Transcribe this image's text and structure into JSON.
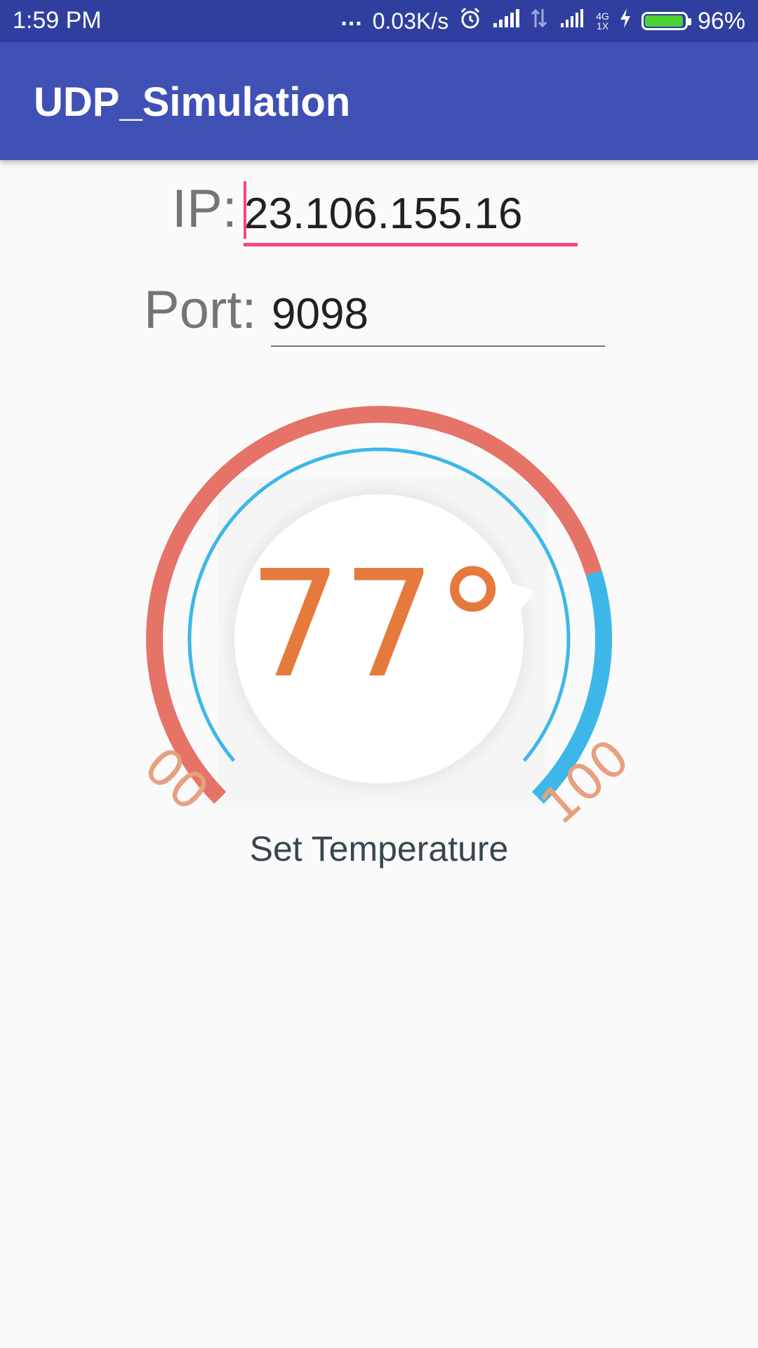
{
  "status_bar": {
    "time": "1:59 PM",
    "dots": "...",
    "net_speed": "0.03K/s",
    "network_label_top": "4G",
    "network_label_bottom": "1X",
    "battery_percent": "96%",
    "battery_level": 0.96,
    "icons": [
      "alarm-icon",
      "signal-icon",
      "data-arrows-icon",
      "signal-4g-icon",
      "charging-bolt-icon",
      "battery-icon"
    ]
  },
  "app_bar": {
    "title": "UDP_Simulation",
    "color": "#3f51b5",
    "status_color": "#303f9f"
  },
  "form": {
    "ip_label": "IP:",
    "ip_value": "23.106.155.16",
    "port_label": "Port:",
    "port_value": "9098",
    "accent_color": "#ff4081"
  },
  "thermostat": {
    "value": 77,
    "display": "77°",
    "min_label": "00",
    "max_label": "100",
    "caption": "Set Temperature",
    "min": 0,
    "max": 100,
    "warm_color": "#e57368",
    "cool_color": "#3db7e9",
    "text_color": "#e57a3c"
  }
}
